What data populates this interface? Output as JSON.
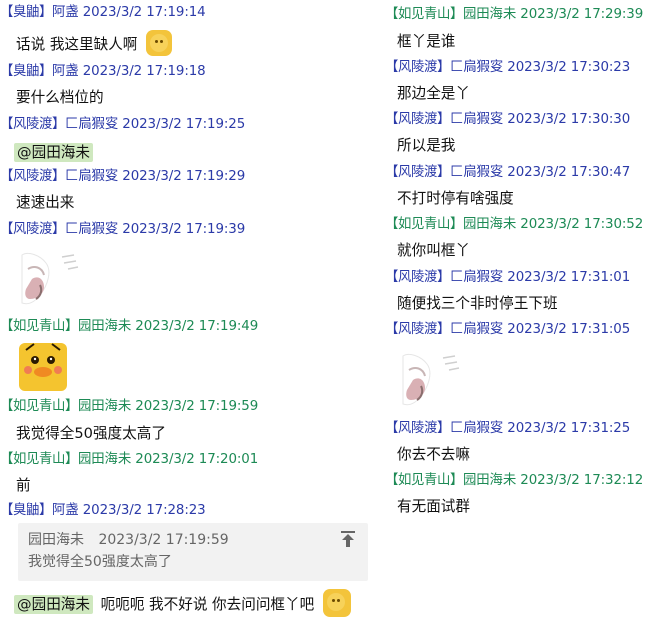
{
  "left": [
    {
      "group": "【臭鼬】",
      "name": "阿盏",
      "time": "2023/3/2 17:19:14",
      "color": "blue",
      "text": "话说 我这里缺人啊",
      "emoji": "smile-face-emoji"
    },
    {
      "group": "【臭鼬】",
      "name": "阿盏",
      "time": "2023/3/2 17:19:18",
      "color": "blue",
      "text": "要什么档位的"
    },
    {
      "group": "【风陵渡】",
      "name": "匚扃猳叜",
      "time": "2023/3/2 17:19:25",
      "color": "blue",
      "mention": "@园田海未"
    },
    {
      "group": "【风陵渡】",
      "name": "匚扃猳叜",
      "time": "2023/3/2 17:19:29",
      "color": "blue",
      "text": "速速出来"
    },
    {
      "group": "【风陵渡】",
      "name": "匚扃猳叜",
      "time": "2023/3/2 17:19:39",
      "color": "blue",
      "sticker": "sitting-character-sticker"
    },
    {
      "group": "【如见青山】",
      "name": "园田海未",
      "time": "2023/3/2 17:19:49",
      "color": "green",
      "sticker": "yellow-duck-sticker"
    },
    {
      "group": "【如见青山】",
      "name": "园田海未",
      "time": "2023/3/2 17:19:59",
      "color": "green",
      "text": "我觉得全50强度太高了"
    },
    {
      "group": "【如见青山】",
      "name": "园田海未",
      "time": "2023/3/2 17:20:01",
      "color": "green",
      "text": "前"
    },
    {
      "group": "【臭鼬】",
      "name": "阿盏",
      "time": "2023/3/2 17:28:23",
      "color": "blue",
      "quote": {
        "author": "园田海未",
        "time": "2023/3/2 17:19:59",
        "text": "我觉得全50强度太高了",
        "pin_icon": "pin-to-top-icon"
      },
      "mention": "@园田海未",
      "text": "呃呃呃 我不好说 你去问问框丫吧",
      "emoji": "thinking-face-emoji"
    }
  ],
  "right": [
    {
      "group": "【如见青山】",
      "name": "园田海未",
      "time": "2023/3/2 17:29:39",
      "color": "green",
      "text": "框丫是谁"
    },
    {
      "group": "【风陵渡】",
      "name": "匚扃猳叜",
      "time": "2023/3/2 17:30:23",
      "color": "blue",
      "text": "那边全是丫"
    },
    {
      "group": "【风陵渡】",
      "name": "匚扃猳叜",
      "time": "2023/3/2 17:30:30",
      "color": "blue",
      "text": "所以是我"
    },
    {
      "group": "【风陵渡】",
      "name": "匚扃猳叜",
      "time": "2023/3/2 17:30:47",
      "color": "blue",
      "text": "不打时停有啥强度"
    },
    {
      "group": "【如见青山】",
      "name": "园田海未",
      "time": "2023/3/2 17:30:52",
      "color": "green",
      "text": "就你叫框丫"
    },
    {
      "group": "【风陵渡】",
      "name": "匚扃猳叜",
      "time": "2023/3/2 17:31:01",
      "color": "blue",
      "text": "随便找三个非时停王下班"
    },
    {
      "group": "【风陵渡】",
      "name": "匚扃猳叜",
      "time": "2023/3/2 17:31:05",
      "color": "blue",
      "sticker": "sitting-character-sticker"
    },
    {
      "group": "【风陵渡】",
      "name": "匚扃猳叜",
      "time": "2023/3/2 17:31:25",
      "color": "blue",
      "text": "你去不去嘛"
    },
    {
      "group": "【如见青山】",
      "name": "园田海未",
      "time": "2023/3/2 17:32:12",
      "color": "green",
      "text": "有无面试群"
    }
  ]
}
